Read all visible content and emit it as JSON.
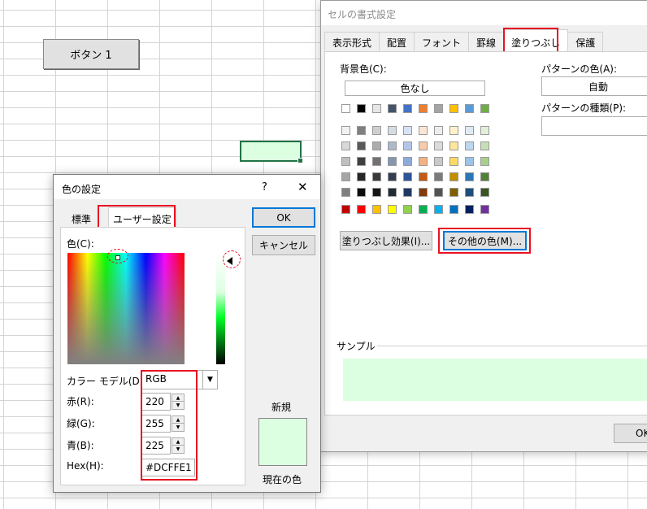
{
  "sheet": {
    "button_label": "ボタン 1"
  },
  "format_dialog": {
    "title": "セルの書式設定",
    "tabs": [
      "表示形式",
      "配置",
      "フォント",
      "罫線",
      "塗りつぶし",
      "保護"
    ],
    "active_tab": "塗りつぶし",
    "background_color_label": "背景色(C):",
    "no_color_label": "色なし",
    "pattern_color_label": "パターンの色(A):",
    "pattern_color_value": "自動",
    "pattern_style_label": "パターンの種類(P):",
    "fill_effects_button": "塗りつぶし効果(I)...",
    "more_colors_button": "その他の色(M)...",
    "sample_label": "サンプル",
    "ok_button": "OK",
    "sample_color": "#dcffe1"
  },
  "color_dialog": {
    "title": "色の設定",
    "help_symbol": "?",
    "close_symbol": "✕",
    "tabs": [
      "標準",
      "ユーザー設定"
    ],
    "active_tab": "ユーザー設定",
    "color_label": "色(C):",
    "ok_button": "OK",
    "cancel_button": "キャンセル",
    "color_model_label": "カラー モデル(D):",
    "color_model_value": "RGB",
    "red_label": "赤(R):",
    "red_value": "220",
    "green_label": "緑(G):",
    "green_value": "255",
    "blue_label": "青(B):",
    "blue_value": "225",
    "hex_label": "Hex(H):",
    "hex_value": "#DCFFE1",
    "new_label": "新規",
    "current_label": "現在の色",
    "current_color": "#dcffe1"
  }
}
